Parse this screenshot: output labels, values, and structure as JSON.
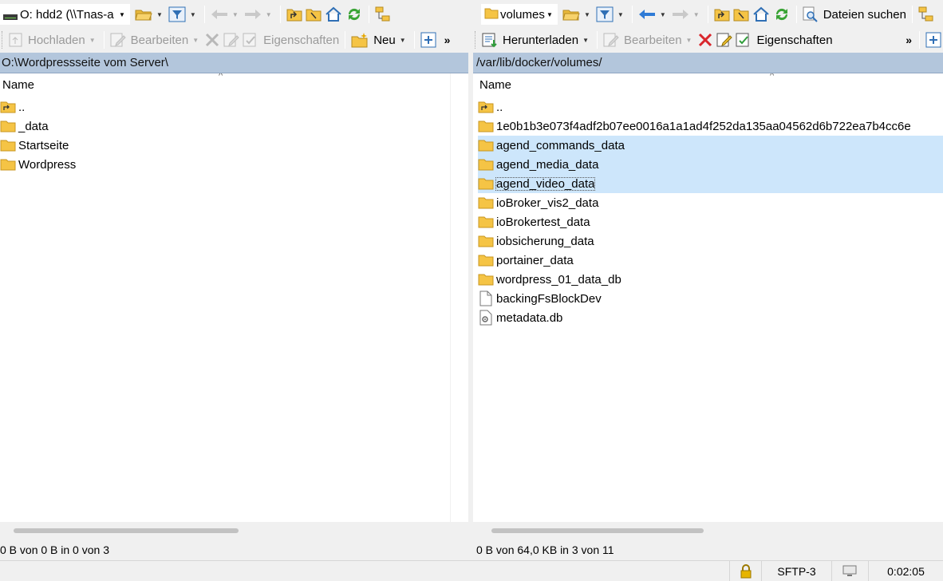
{
  "left": {
    "drive_label": "O: hdd2 (\\\\Tnas-a",
    "toolbar2": {
      "upload": "Hochladen",
      "edit": "Bearbeiten",
      "properties": "Eigenschaften",
      "new": "Neu"
    },
    "path": "O:\\Wordpressseite vom Server\\",
    "col_name": "Name",
    "rows": [
      {
        "name": "..",
        "type": "parent"
      },
      {
        "name": "_data",
        "type": "folder"
      },
      {
        "name": "Startseite",
        "type": "folder"
      },
      {
        "name": "Wordpress",
        "type": "folder"
      }
    ],
    "status": "0 B von 0 B in 0 von 3"
  },
  "right": {
    "drive_label": "volumes",
    "find_files": "Dateien suchen",
    "toolbar2": {
      "download": "Herunterladen",
      "edit": "Bearbeiten",
      "properties": "Eigenschaften"
    },
    "path": "/var/lib/docker/volumes/",
    "col_name": "Name",
    "rows": [
      {
        "name": "..",
        "type": "parent"
      },
      {
        "name": "1e0b1b3e073f4adf2b07ee0016a1a1ad4f252da135aa04562d6b722ea7b4cc6e",
        "type": "folder"
      },
      {
        "name": "agend_commands_data",
        "type": "folder",
        "selected": true
      },
      {
        "name": "agend_media_data",
        "type": "folder",
        "selected": true
      },
      {
        "name": "agend_video_data",
        "type": "folder",
        "selected": true,
        "focused": true
      },
      {
        "name": "ioBroker_vis2_data",
        "type": "folder"
      },
      {
        "name": "ioBrokertest_data",
        "type": "folder"
      },
      {
        "name": "iobsicherung_data",
        "type": "folder"
      },
      {
        "name": "portainer_data",
        "type": "folder"
      },
      {
        "name": "wordpress_01_data_db",
        "type": "folder"
      },
      {
        "name": "backingFsBlockDev",
        "type": "file"
      },
      {
        "name": "metadata.db",
        "type": "dbfile"
      }
    ],
    "status": "0 B von 64,0 KB in 3 von 11"
  },
  "bottombar": {
    "protocol": "SFTP-3",
    "time": "0:02:05"
  },
  "icons": {
    "folder": "folder-icon",
    "parent": "parent-folder-icon",
    "file": "file-icon",
    "dbfile": "settings-file-icon"
  },
  "colors": {
    "selection": "#cde6fb",
    "pathbar": "#b3c6dc",
    "folder": "#f5c445"
  }
}
